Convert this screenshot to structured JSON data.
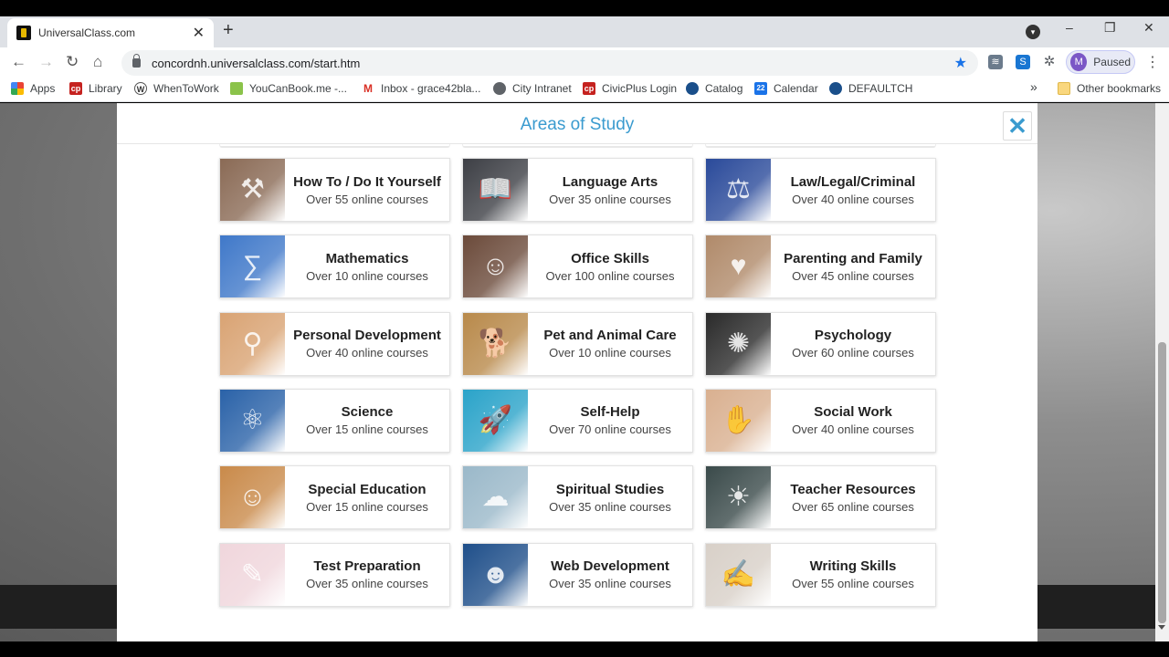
{
  "browser": {
    "tab_title": "UniversalClass.com",
    "tab_close": "✕",
    "new_tab": "+",
    "minimize": "–",
    "restore": "❐",
    "close": "✕",
    "url": "concordnh.universalclass.com/start.htm",
    "profile_initial": "M",
    "profile_status": "Paused"
  },
  "bookmarks": [
    {
      "label": "Apps",
      "icon": "apps-grid-icon",
      "color": "#e94235"
    },
    {
      "label": "Library",
      "icon": "cp-icon",
      "color": "#c5221f"
    },
    {
      "label": "WhenToWork",
      "icon": "w-icon",
      "color": "#555555"
    },
    {
      "label": "YouCanBook.me -...",
      "icon": "ycb-icon",
      "color": "#8bc34a"
    },
    {
      "label": "Inbox - grace42bla...",
      "icon": "gmail-icon",
      "color": "#d93025"
    },
    {
      "label": "City Intranet",
      "icon": "globe-icon",
      "color": "#5f6368"
    },
    {
      "label": "CivicPlus Login",
      "icon": "cp-icon",
      "color": "#c5221f"
    },
    {
      "label": "Catalog",
      "icon": "globe-icon",
      "color": "#1a4f8a"
    },
    {
      "label": "Calendar",
      "icon": "calendar-icon",
      "color": "#1a73e8"
    },
    {
      "label": "DEFAULTCH",
      "icon": "globe-icon",
      "color": "#1a4f8a"
    }
  ],
  "bookmarks_overflow": "»",
  "other_bookmarks": "Other bookmarks",
  "modal": {
    "title": "Areas of Study",
    "close_glyph": "✕"
  },
  "courses": [
    {
      "title": "How To / Do It Yourself",
      "count": "Over 55 online courses",
      "thumb": "#8a6a55",
      "icon": "hammer-icon"
    },
    {
      "title": "Language Arts",
      "count": "Over 35 online courses",
      "thumb": "#3d3f45",
      "icon": "open-book-icon"
    },
    {
      "title": "Law/Legal/Criminal",
      "count": "Over 40 online courses",
      "thumb": "#2a4a9a",
      "icon": "gavel-icon"
    },
    {
      "title": "Mathematics",
      "count": "Over 10 online courses",
      "thumb": "#3f78c9",
      "icon": "math-formula-icon"
    },
    {
      "title": "Office Skills",
      "count": "Over 100 online courses",
      "thumb": "#6b4a3a",
      "icon": "headset-person-icon"
    },
    {
      "title": "Parenting and Family",
      "count": "Over 45 online courses",
      "thumb": "#b08a6a",
      "icon": "family-icon"
    },
    {
      "title": "Personal Development",
      "count": "Over 40 online courses",
      "thumb": "#d9a373",
      "icon": "raised-arms-icon"
    },
    {
      "title": "Pet and Animal Care",
      "count": "Over 10 online courses",
      "thumb": "#b8894a",
      "icon": "dog-icon"
    },
    {
      "title": "Psychology",
      "count": "Over 60 online courses",
      "thumb": "#2a2a2a",
      "icon": "brain-icon"
    },
    {
      "title": "Science",
      "count": "Over 15 online courses",
      "thumb": "#2a62a8",
      "icon": "molecule-icon"
    },
    {
      "title": "Self-Help",
      "count": "Over 70 online courses",
      "thumb": "#2aa3c9",
      "icon": "rocket-icon"
    },
    {
      "title": "Social Work",
      "count": "Over 40 online courses",
      "thumb": "#d9b090",
      "icon": "handshake-icon"
    },
    {
      "title": "Special Education",
      "count": "Over 15 online courses",
      "thumb": "#c98a4a",
      "icon": "child-icon"
    },
    {
      "title": "Spiritual Studies",
      "count": "Over 35 online courses",
      "thumb": "#9ab8c9",
      "icon": "sky-icon"
    },
    {
      "title": "Teacher Resources",
      "count": "Over 65 online courses",
      "thumb": "#3a4a4a",
      "icon": "lightbulb-icon"
    },
    {
      "title": "Test Preparation",
      "count": "Over 35 online courses",
      "thumb": "#f0d6dc",
      "icon": "answer-sheet-icon"
    },
    {
      "title": "Web Development",
      "count": "Over 35 online courses",
      "thumb": "#1f4f8a",
      "icon": "digital-face-icon"
    },
    {
      "title": "Writing Skills",
      "count": "Over 55 online courses",
      "thumb": "#d8d0c8",
      "icon": "pencil-hand-icon"
    }
  ],
  "colors": {
    "accent": "#3a9bcf",
    "omnibox_bg": "#f1f3f4",
    "star": "#1a73e8",
    "avatar": "#7b57c6"
  }
}
